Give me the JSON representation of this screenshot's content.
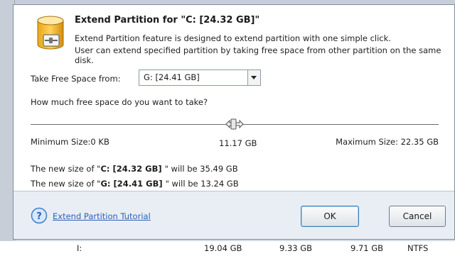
{
  "dialog": {
    "title": "Extend Partition for \"C: [24.32 GB]\"",
    "description_line1": "Extend Partition feature is designed to extend partition with one simple click.",
    "description_line2": "User can extend specified partition by taking free space from other partition on the same disk."
  },
  "take_from": {
    "label": "Take Free Space from:",
    "selected": "G:  [24.41 GB]"
  },
  "question": "How much free space do you want to take?",
  "slider": {
    "min_label": "Minimum Size:0 KB",
    "max_label": "Maximum Size: 22.35 GB",
    "current_label": "11.17 GB",
    "current_fraction": 0.5
  },
  "result": {
    "c_prefix": "The new size of \"",
    "c_drive": "C: [24.32 GB] ",
    "c_suffix": "\" will be 35.49 GB",
    "g_prefix": "The new size of \"",
    "g_drive": "G: [24.41 GB] ",
    "g_suffix": "\" will be 13.24 GB"
  },
  "footer": {
    "tutorial_link": "Extend Partition Tutorial",
    "ok_label": "OK",
    "cancel_label": "Cancel"
  },
  "background_row": {
    "drive": "I:",
    "capacity": "19.04 GB",
    "used": "9.33 GB",
    "free": "9.71 GB",
    "fs": "NTFS"
  },
  "icons": {
    "header": "database-partition-icon",
    "help": "question-circle-icon",
    "slider_thumb": "slider-thumb-icon",
    "dropdown": "chevron-down-icon"
  },
  "colors": {
    "link": "#2c5fb8",
    "footer_bg": "#e9eef5",
    "ok_border": "#3c7fb1"
  }
}
